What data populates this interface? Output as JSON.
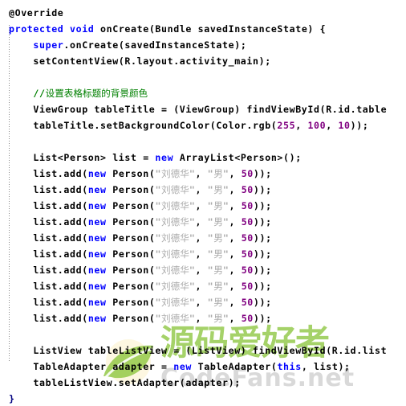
{
  "editor": {
    "background_color": "#ffffff",
    "language": "java",
    "font_size_px": 11.6,
    "line_height_px": 20,
    "indent_guide": {
      "visible": true,
      "style": "dotted",
      "color": "#8a8a8a"
    }
  },
  "theme": {
    "plain": "#000000",
    "keyword": "#0000ff",
    "comment": "#008000",
    "string": "#aaaaaa",
    "number": "#800080",
    "brace": "#000080"
  },
  "watermark": {
    "chinese_text": "源码爱好者",
    "latin_text": "CodeFans.net",
    "chinese_color": "#8dc63f",
    "latin_color": "#d9d9d9",
    "logo_icon": "leaf-icon"
  },
  "code_lines": [
    {
      "id": "line-1",
      "indent": 0,
      "tokens": [
        {
          "type": "anno",
          "text": "@Override"
        }
      ]
    },
    {
      "id": "line-2",
      "indent": 0,
      "tokens": [
        {
          "type": "keyword",
          "text": "protected void "
        },
        {
          "type": "plain",
          "text": "onCreate(Bundle savedInstanceState) {"
        }
      ]
    },
    {
      "id": "line-3",
      "indent": 1,
      "tokens": [
        {
          "type": "keyword",
          "text": "super"
        },
        {
          "type": "plain",
          "text": ".onCreate(savedInstanceState);"
        }
      ]
    },
    {
      "id": "line-4",
      "indent": 1,
      "tokens": [
        {
          "type": "plain",
          "text": "setContentView(R.layout.activity_main);"
        }
      ]
    },
    {
      "id": "line-5",
      "indent": 1,
      "tokens": []
    },
    {
      "id": "line-6",
      "indent": 1,
      "tokens": [
        {
          "type": "comment",
          "text": "//"
        },
        {
          "type": "cjkcom",
          "text": "设置表格标题的背景颜色"
        }
      ]
    },
    {
      "id": "line-7",
      "indent": 1,
      "tokens": [
        {
          "type": "plain",
          "text": "ViewGroup tableTitle = (ViewGroup) findViewById(R.id.table"
        }
      ]
    },
    {
      "id": "line-8",
      "indent": 1,
      "tokens": [
        {
          "type": "plain",
          "text": "tableTitle.setBackgroundColor(Color.rgb("
        },
        {
          "type": "number",
          "text": "255"
        },
        {
          "type": "plain",
          "text": ", "
        },
        {
          "type": "number",
          "text": "100"
        },
        {
          "type": "plain",
          "text": ", "
        },
        {
          "type": "number",
          "text": "10"
        },
        {
          "type": "plain",
          "text": "));"
        }
      ]
    },
    {
      "id": "line-9",
      "indent": 1,
      "tokens": []
    },
    {
      "id": "line-10",
      "indent": 1,
      "tokens": [
        {
          "type": "plain",
          "text": "List<Person> list = "
        },
        {
          "type": "keyword",
          "text": "new"
        },
        {
          "type": "plain",
          "text": " ArrayList<Person>();"
        }
      ]
    },
    {
      "id": "line-11",
      "indent": 1,
      "tokens": [
        {
          "type": "plain",
          "text": "list.add("
        },
        {
          "type": "keyword",
          "text": "new"
        },
        {
          "type": "plain",
          "text": " Person("
        },
        {
          "type": "string",
          "text": "\""
        },
        {
          "type": "cjkstr",
          "text": "刘德华"
        },
        {
          "type": "string",
          "text": "\""
        },
        {
          "type": "plain",
          "text": ", "
        },
        {
          "type": "string",
          "text": "\""
        },
        {
          "type": "cjkstr",
          "text": "男"
        },
        {
          "type": "string",
          "text": "\""
        },
        {
          "type": "plain",
          "text": ", "
        },
        {
          "type": "number",
          "text": "50"
        },
        {
          "type": "plain",
          "text": "));"
        }
      ]
    },
    {
      "id": "line-12",
      "indent": 1,
      "tokens": [
        {
          "type": "plain",
          "text": "list.add("
        },
        {
          "type": "keyword",
          "text": "new"
        },
        {
          "type": "plain",
          "text": " Person("
        },
        {
          "type": "string",
          "text": "\""
        },
        {
          "type": "cjkstr",
          "text": "刘德华"
        },
        {
          "type": "string",
          "text": "\""
        },
        {
          "type": "plain",
          "text": ", "
        },
        {
          "type": "string",
          "text": "\""
        },
        {
          "type": "cjkstr",
          "text": "男"
        },
        {
          "type": "string",
          "text": "\""
        },
        {
          "type": "plain",
          "text": ", "
        },
        {
          "type": "number",
          "text": "50"
        },
        {
          "type": "plain",
          "text": "));"
        }
      ]
    },
    {
      "id": "line-13",
      "indent": 1,
      "tokens": [
        {
          "type": "plain",
          "text": "list.add("
        },
        {
          "type": "keyword",
          "text": "new"
        },
        {
          "type": "plain",
          "text": " Person("
        },
        {
          "type": "string",
          "text": "\""
        },
        {
          "type": "cjkstr",
          "text": "刘德华"
        },
        {
          "type": "string",
          "text": "\""
        },
        {
          "type": "plain",
          "text": ", "
        },
        {
          "type": "string",
          "text": "\""
        },
        {
          "type": "cjkstr",
          "text": "男"
        },
        {
          "type": "string",
          "text": "\""
        },
        {
          "type": "plain",
          "text": ", "
        },
        {
          "type": "number",
          "text": "50"
        },
        {
          "type": "plain",
          "text": "));"
        }
      ]
    },
    {
      "id": "line-14",
      "indent": 1,
      "tokens": [
        {
          "type": "plain",
          "text": "list.add("
        },
        {
          "type": "keyword",
          "text": "new"
        },
        {
          "type": "plain",
          "text": " Person("
        },
        {
          "type": "string",
          "text": "\""
        },
        {
          "type": "cjkstr",
          "text": "刘德华"
        },
        {
          "type": "string",
          "text": "\""
        },
        {
          "type": "plain",
          "text": ", "
        },
        {
          "type": "string",
          "text": "\""
        },
        {
          "type": "cjkstr",
          "text": "男"
        },
        {
          "type": "string",
          "text": "\""
        },
        {
          "type": "plain",
          "text": ", "
        },
        {
          "type": "number",
          "text": "50"
        },
        {
          "type": "plain",
          "text": "));"
        }
      ]
    },
    {
      "id": "line-15",
      "indent": 1,
      "tokens": [
        {
          "type": "plain",
          "text": "list.add("
        },
        {
          "type": "keyword",
          "text": "new"
        },
        {
          "type": "plain",
          "text": " Person("
        },
        {
          "type": "string",
          "text": "\""
        },
        {
          "type": "cjkstr",
          "text": "刘德华"
        },
        {
          "type": "string",
          "text": "\""
        },
        {
          "type": "plain",
          "text": ", "
        },
        {
          "type": "string",
          "text": "\""
        },
        {
          "type": "cjkstr",
          "text": "男"
        },
        {
          "type": "string",
          "text": "\""
        },
        {
          "type": "plain",
          "text": ", "
        },
        {
          "type": "number",
          "text": "50"
        },
        {
          "type": "plain",
          "text": "));"
        }
      ]
    },
    {
      "id": "line-16",
      "indent": 1,
      "tokens": [
        {
          "type": "plain",
          "text": "list.add("
        },
        {
          "type": "keyword",
          "text": "new"
        },
        {
          "type": "plain",
          "text": " Person("
        },
        {
          "type": "string",
          "text": "\""
        },
        {
          "type": "cjkstr",
          "text": "刘德华"
        },
        {
          "type": "string",
          "text": "\""
        },
        {
          "type": "plain",
          "text": ", "
        },
        {
          "type": "string",
          "text": "\""
        },
        {
          "type": "cjkstr",
          "text": "男"
        },
        {
          "type": "string",
          "text": "\""
        },
        {
          "type": "plain",
          "text": ", "
        },
        {
          "type": "number",
          "text": "50"
        },
        {
          "type": "plain",
          "text": "));"
        }
      ]
    },
    {
      "id": "line-17",
      "indent": 1,
      "tokens": [
        {
          "type": "plain",
          "text": "list.add("
        },
        {
          "type": "keyword",
          "text": "new"
        },
        {
          "type": "plain",
          "text": " Person("
        },
        {
          "type": "string",
          "text": "\""
        },
        {
          "type": "cjkstr",
          "text": "刘德华"
        },
        {
          "type": "string",
          "text": "\""
        },
        {
          "type": "plain",
          "text": ", "
        },
        {
          "type": "string",
          "text": "\""
        },
        {
          "type": "cjkstr",
          "text": "男"
        },
        {
          "type": "string",
          "text": "\""
        },
        {
          "type": "plain",
          "text": ", "
        },
        {
          "type": "number",
          "text": "50"
        },
        {
          "type": "plain",
          "text": "));"
        }
      ]
    },
    {
      "id": "line-18",
      "indent": 1,
      "tokens": [
        {
          "type": "plain",
          "text": "list.add("
        },
        {
          "type": "keyword",
          "text": "new"
        },
        {
          "type": "plain",
          "text": " Person("
        },
        {
          "type": "string",
          "text": "\""
        },
        {
          "type": "cjkstr",
          "text": "刘德华"
        },
        {
          "type": "string",
          "text": "\""
        },
        {
          "type": "plain",
          "text": ", "
        },
        {
          "type": "string",
          "text": "\""
        },
        {
          "type": "cjkstr",
          "text": "男"
        },
        {
          "type": "string",
          "text": "\""
        },
        {
          "type": "plain",
          "text": ", "
        },
        {
          "type": "number",
          "text": "50"
        },
        {
          "type": "plain",
          "text": "));"
        }
      ]
    },
    {
      "id": "line-19",
      "indent": 1,
      "tokens": [
        {
          "type": "plain",
          "text": "list.add("
        },
        {
          "type": "keyword",
          "text": "new"
        },
        {
          "type": "plain",
          "text": " Person("
        },
        {
          "type": "string",
          "text": "\""
        },
        {
          "type": "cjkstr",
          "text": "刘德华"
        },
        {
          "type": "string",
          "text": "\""
        },
        {
          "type": "plain",
          "text": ", "
        },
        {
          "type": "string",
          "text": "\""
        },
        {
          "type": "cjkstr",
          "text": "男"
        },
        {
          "type": "string",
          "text": "\""
        },
        {
          "type": "plain",
          "text": ", "
        },
        {
          "type": "number",
          "text": "50"
        },
        {
          "type": "plain",
          "text": "));"
        }
      ]
    },
    {
      "id": "line-20",
      "indent": 1,
      "tokens": [
        {
          "type": "plain",
          "text": "list.add("
        },
        {
          "type": "keyword",
          "text": "new"
        },
        {
          "type": "plain",
          "text": " Person("
        },
        {
          "type": "string",
          "text": "\""
        },
        {
          "type": "cjkstr",
          "text": "刘德华"
        },
        {
          "type": "string",
          "text": "\""
        },
        {
          "type": "plain",
          "text": ", "
        },
        {
          "type": "string",
          "text": "\""
        },
        {
          "type": "cjkstr",
          "text": "男"
        },
        {
          "type": "string",
          "text": "\""
        },
        {
          "type": "plain",
          "text": ", "
        },
        {
          "type": "number",
          "text": "50"
        },
        {
          "type": "plain",
          "text": "));"
        }
      ]
    },
    {
      "id": "line-21",
      "indent": 1,
      "tokens": []
    },
    {
      "id": "line-22",
      "indent": 1,
      "tokens": [
        {
          "type": "plain",
          "text": "ListView tableListView = (ListView) findViewById(R.id.list"
        }
      ]
    },
    {
      "id": "line-23",
      "indent": 1,
      "tokens": [
        {
          "type": "plain",
          "text": "TableAdapter adapter = "
        },
        {
          "type": "keyword",
          "text": "new"
        },
        {
          "type": "plain",
          "text": " TableAdapter("
        },
        {
          "type": "keyword",
          "text": "this"
        },
        {
          "type": "plain",
          "text": ", list);"
        }
      ]
    },
    {
      "id": "line-24",
      "indent": 1,
      "tokens": [
        {
          "type": "plain",
          "text": "tableListView.setAdapter(adapter);"
        }
      ]
    },
    {
      "id": "line-25",
      "indent": 0,
      "tokens": [
        {
          "type": "brace",
          "text": "}"
        }
      ]
    }
  ]
}
